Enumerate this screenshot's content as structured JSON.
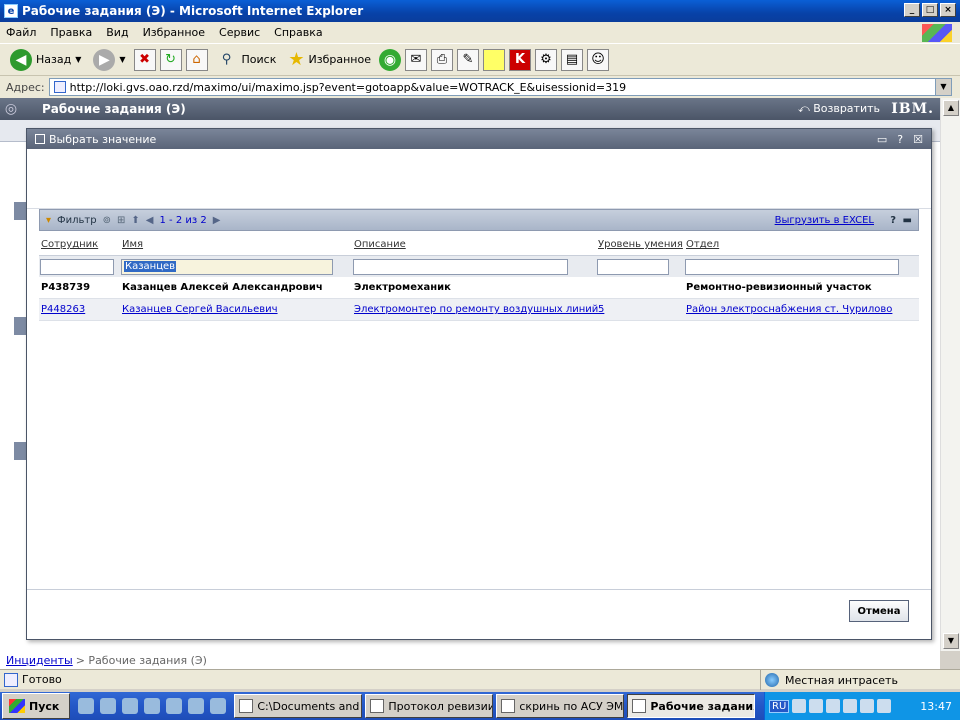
{
  "window": {
    "title": "Рабочие задания (Э) - Microsoft Internet Explorer",
    "min": "_",
    "max": "□",
    "close": "×"
  },
  "menu": [
    "Файл",
    "Правка",
    "Вид",
    "Избранное",
    "Сервис",
    "Справка"
  ],
  "toolbar": {
    "back": "Назад",
    "search": "Поиск",
    "favorites": "Избранное"
  },
  "address": {
    "label": "Адрес:",
    "url": "http://loki.gvs.oao.rzd/maximo/ui/maximo.jsp?event=gotoapp&value=WOTRACK_E&uisessionid=319"
  },
  "app": {
    "title": "Рабочие задания (Э)",
    "back_link": "Возвратить",
    "brand": "IBM."
  },
  "dialog": {
    "title": "Выбрать значение",
    "filter_label": "Фильтр",
    "range": "1 - 2 из 2",
    "export": "Выгрузить в EXCEL",
    "help": "?",
    "cancel": "Отмена"
  },
  "table": {
    "columns": [
      "Сотрудник",
      "Имя",
      "Описание",
      "Уровень умения",
      "Отдел"
    ],
    "filter_name": "Казанцев",
    "rows": [
      {
        "emp": "P438739",
        "name": "Казанцев Алексей Александрович",
        "desc": "Электромеханик",
        "level": "",
        "dept": "Ремонтно-ревизионный участок"
      },
      {
        "emp": "P448263",
        "name": "Казанцев Сергей Васильевич",
        "desc": "Электромонтер по ремонту воздушных линий",
        "level": "5",
        "dept": "Район электроснабжения ст. Чурилово"
      }
    ]
  },
  "breadcrumb": {
    "link": "Инциденты",
    "current": "> Рабочие задания (Э)"
  },
  "status": {
    "left": "Готово",
    "zone": "Местная интрасеть"
  },
  "taskbar": {
    "start": "Пуск",
    "tasks": [
      "C:\\Documents and S...",
      "Протокол ревизии ...",
      "скринь по АСУ ЭМ ...",
      "Рабочие задания..."
    ],
    "lang": "RU",
    "clock": "13:47"
  }
}
